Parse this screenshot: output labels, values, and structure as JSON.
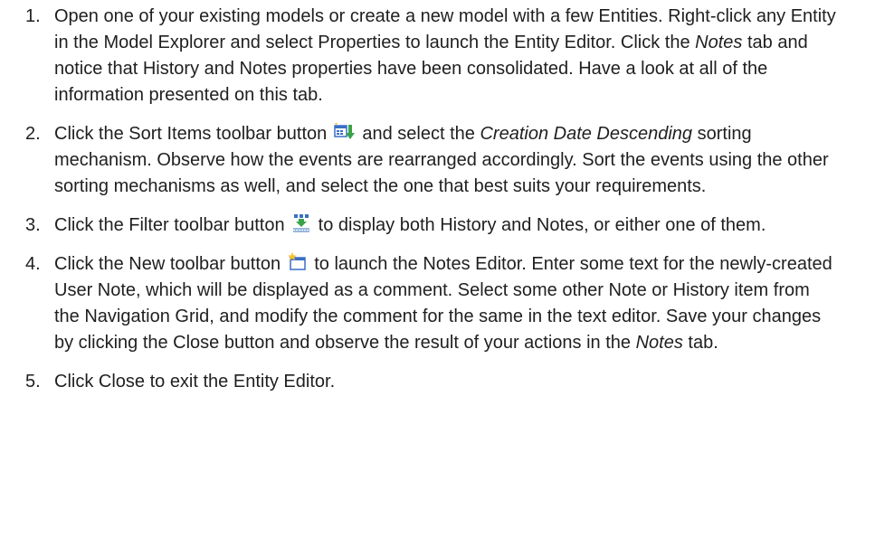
{
  "steps": [
    {
      "number": "1.",
      "parts": [
        "Open one of your existing models or create a new model with a few Entities. Right-click any Entity in the Model Explorer and select Properties to launch the Entity Editor. Click the ",
        "Notes",
        " tab and notice that History and Notes properties have been consolidated. Have a look at all of the information presented on this tab."
      ]
    },
    {
      "number": "2.",
      "icon": "sort-items-icon",
      "parts": [
        "Click the Sort Items toolbar button ",
        " and select the ",
        "Creation Date Descending",
        " sorting mechanism. Observe how the events are rearranged accordingly. Sort the events using the other sorting mechanisms as well, and select the one that best suits your requirements."
      ]
    },
    {
      "number": "3.",
      "icon": "filter-icon",
      "parts": [
        "Click the Filter toolbar button ",
        " to display both History and Notes, or either one of them."
      ]
    },
    {
      "number": "4.",
      "icon": "new-note-icon",
      "parts": [
        "Click the New toolbar button ",
        " to launch the Notes Editor. Enter some text for the newly-created User Note, which will be displayed as a comment. Select some other Note or History item from the Navigation Grid, and modify the comment for the same in the text editor. Save your changes by clicking the Close button and observe the result of your actions in the ",
        "Notes",
        " tab."
      ]
    },
    {
      "number": "5.",
      "parts": [
        "Click Close to exit the Entity Editor."
      ]
    }
  ],
  "colors": {
    "text": "#1f1f1f",
    "icon_blue": "#3a6fc4",
    "icon_green": "#3aa34a",
    "icon_yellow": "#f2c230"
  }
}
